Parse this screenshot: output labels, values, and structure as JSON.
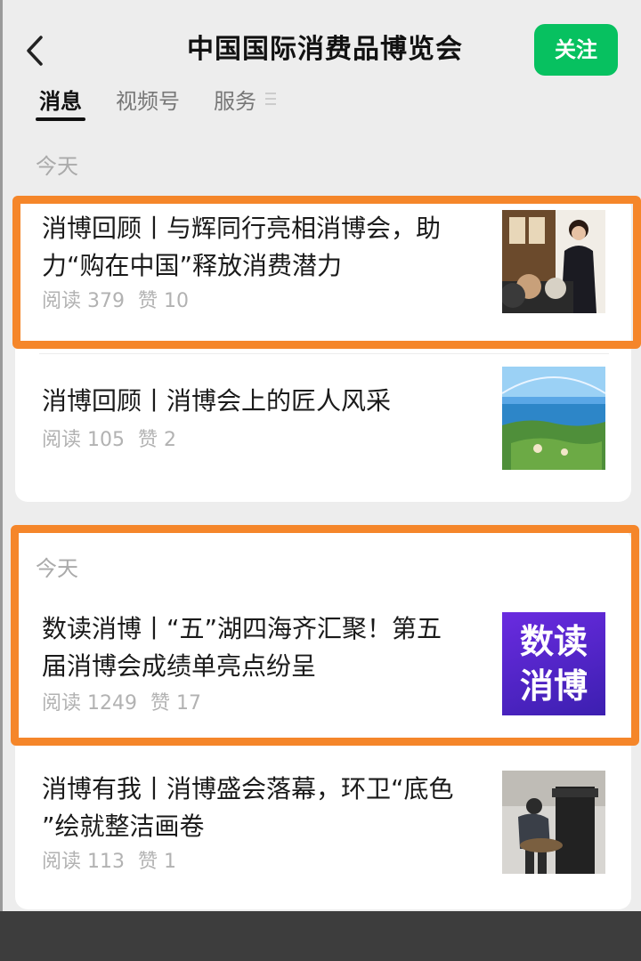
{
  "header": {
    "title": "中国国际消费品博览会",
    "follow_label": "关注"
  },
  "tabs": [
    {
      "label": "消息",
      "active": true
    },
    {
      "label": "视频号",
      "active": false
    },
    {
      "label": "服务",
      "active": false
    }
  ],
  "groups": [
    {
      "date": "今天",
      "articles": [
        {
          "title_line1": "消博回顾丨与辉同行亮相消博会，助",
          "title_line2": "力“购在中国”释放消费潜力",
          "reads": "阅读 379",
          "likes": "赞 10",
          "thumb_icon": "presenter-photo"
        },
        {
          "title_line1": "消博回顾丨消博会上的匠人风采",
          "title_line2": "",
          "reads": "阅读 105",
          "likes": "赞 2",
          "thumb_icon": "island-photo"
        }
      ]
    },
    {
      "date": "今天",
      "articles": [
        {
          "title_line1": "数读消博丨“五”湖四海齐汇聚！第五",
          "title_line2": "届消博会成绩单亮点纷呈",
          "reads": "阅读 1249",
          "likes": "赞 17",
          "thumb_text_1": "数读",
          "thumb_text_2": "消博"
        },
        {
          "title_line1": "消博有我丨消博盛会落幕，环卫“底色",
          "title_line2": "”绘就整洁画卷",
          "reads": "阅读 113",
          "likes": "赞 1",
          "thumb_icon": "sanitation-worker-photo"
        }
      ]
    }
  ],
  "colors": {
    "accent_green": "#07c160",
    "highlight_orange": "#f5862a",
    "thumb_purple": "#5b2bd6"
  }
}
